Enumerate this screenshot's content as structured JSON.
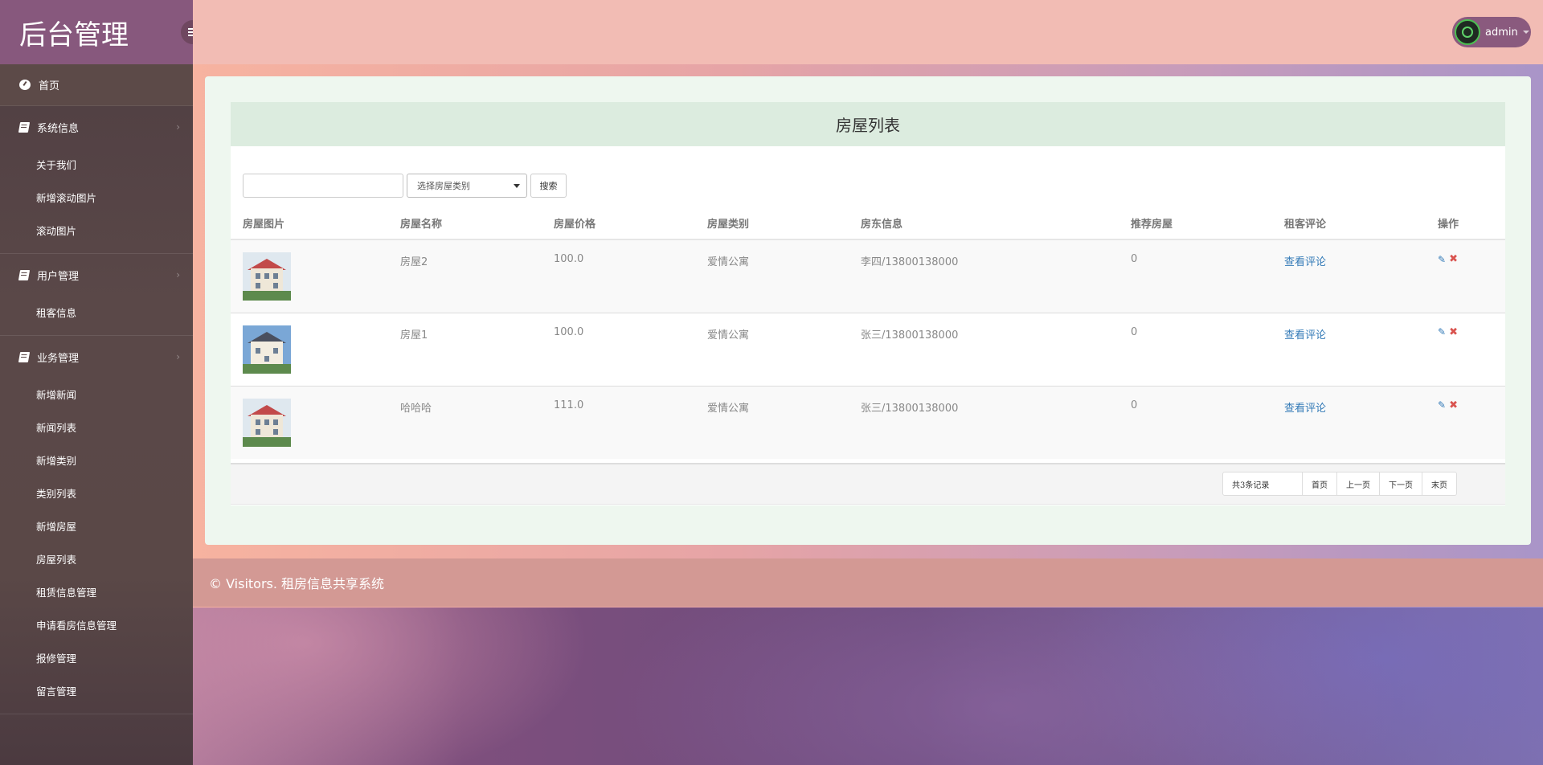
{
  "brand": "后台管理",
  "user": {
    "name": "admin"
  },
  "sidebar": {
    "home": "首页",
    "sections": [
      {
        "title": "系统信息",
        "items": [
          "关于我们",
          "新增滚动图片",
          "滚动图片"
        ]
      },
      {
        "title": "用户管理",
        "items": [
          "租客信息"
        ]
      },
      {
        "title": "业务管理",
        "items": [
          "新增新闻",
          "新闻列表",
          "新增类别",
          "类别列表",
          "新增房屋",
          "房屋列表",
          "租赁信息管理",
          "申请看房信息管理",
          "报修管理",
          "留言管理"
        ]
      }
    ]
  },
  "page": {
    "title": "房屋列表",
    "search": {
      "value": "",
      "category_selected": "选择房屋类别",
      "button": "搜索"
    },
    "columns": [
      "房屋图片",
      "房屋名称",
      "房屋价格",
      "房屋类别",
      "房东信息",
      "推荐房屋",
      "租客评论",
      "操作"
    ],
    "rows": [
      {
        "name": "房屋2",
        "price": "100.0",
        "category": "爱情公寓",
        "landlord": "李四/13800138000",
        "recommend": "0",
        "comment_link": "查看评论",
        "image": "house-photo-a"
      },
      {
        "name": "房屋1",
        "price": "100.0",
        "category": "爱情公寓",
        "landlord": "张三/13800138000",
        "recommend": "0",
        "comment_link": "查看评论",
        "image": "house-photo-b"
      },
      {
        "name": "哈哈哈",
        "price": "111.0",
        "category": "爱情公寓",
        "landlord": "张三/13800138000",
        "recommend": "0",
        "comment_link": "查看评论",
        "image": "house-photo-a"
      }
    ],
    "pager": {
      "info": "共3条记录",
      "first": "首页",
      "prev": "上一页",
      "next": "下一页",
      "last": "末页"
    }
  },
  "footer": "© Visitors. 租房信息共享系统",
  "icons": {
    "toggle": "bars-icon",
    "home": "dashboard-icon",
    "section": "book-icon",
    "edit": "edit-icon",
    "delete": "close-icon"
  },
  "colors": {
    "brand_bg": "#87587d",
    "topbar": "#f2bcb4",
    "link": "#337ab7",
    "delete": "#d9534f",
    "footer": "#d39994"
  }
}
